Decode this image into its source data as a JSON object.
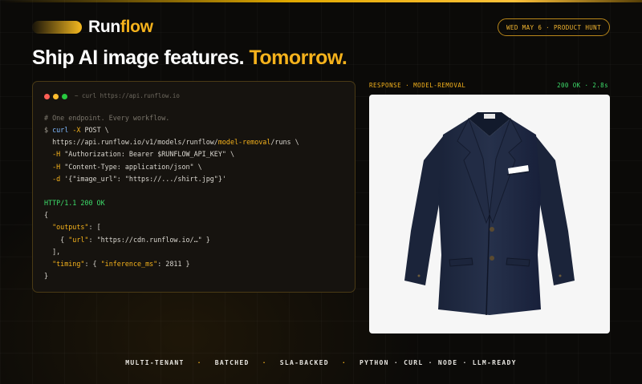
{
  "brand": {
    "name_a": "Run",
    "name_b": "flow"
  },
  "badge": {
    "date_label": "WED MAY 6 · PRODUCT HUNT"
  },
  "headline": {
    "part1": "Ship AI image features.",
    "part2": "Tomorrow."
  },
  "terminal": {
    "title": "~ curl https://api.runflow.io",
    "comment": "# One endpoint. Every workflow.",
    "prompt": "$",
    "command": "curl",
    "method_flag": "-X",
    "method": "POST \\",
    "url_prefix": "https://api.runflow.io/v1/models/runflow/",
    "url_model": "model-removal",
    "url_suffix": "/runs \\",
    "header_flag": "-H",
    "auth_header": "\"Authorization: Bearer $RUNFLOW_API_KEY\" \\",
    "content_header": "\"Content-Type: application/json\" \\",
    "data_flag": "-d",
    "data_body": "'{\"image_url\": \"https://.../shirt.jpg\"}'",
    "http_status": "HTTP/1.1 200 OK",
    "open_brace": "{",
    "outputs_key": "\"outputs\"",
    "outputs_open": ": [",
    "item_open": "{",
    "url_key": "\"url\"",
    "url_value": ": \"https://cdn.runflow.io/…\" }",
    "outputs_close": "],",
    "timing_key": "\"timing\"",
    "timing_open": ": {",
    "inference_key": "\"inference_ms\"",
    "inference_value": ": 2811 }",
    "close_brace": "}"
  },
  "response": {
    "label": "RESPONSE · MODEL-REMOVAL",
    "status": "200 OK · 2.8s",
    "image_subject": "navy-blazer-product-photo"
  },
  "features": [
    "MULTI-TENANT",
    "BATCHED",
    "SLA-BACKED",
    "PYTHON · CURL · NODE · LLM-READY"
  ],
  "feature_separator": "·",
  "colors": {
    "accent": "#f5b21c",
    "background": "#0b0a08",
    "success": "#3ddc6a",
    "command": "#7eb8ff"
  }
}
